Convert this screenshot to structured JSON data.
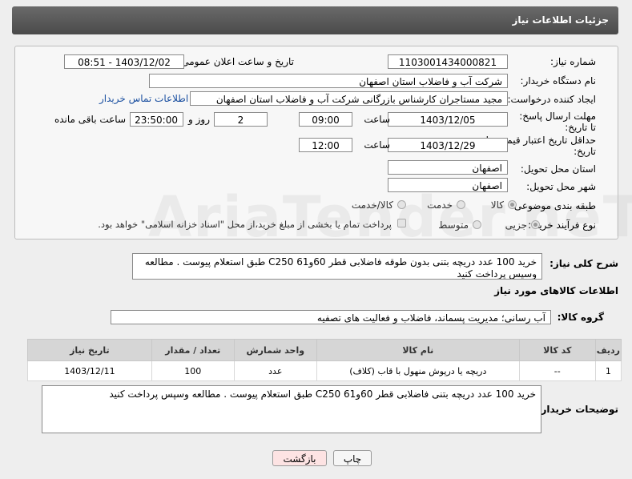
{
  "header": {
    "title": "جزئیات اطلاعات نیاز"
  },
  "fields": {
    "need_number_label": "شماره نیاز:",
    "need_number": "1103001434000821",
    "announce_label": "تاریخ و ساعت اعلان عمومی:",
    "announce_value": "1403/12/02 - 08:51",
    "buyer_org_label": "نام دستگاه خریدار:",
    "buyer_org": "شرکت آب و فاضلاب استان اصفهان",
    "creator_label": "ایجاد کننده درخواست:",
    "creator": "مجید مستاجران کارشناس بازرگانی شرکت آب و فاضلاب استان اصفهان",
    "contact_link": "اطلاعات تماس خریدار",
    "deadline_label": "مهلت ارسال پاسخ: تا تاریخ:",
    "deadline_date": "1403/12/05",
    "time_label": "ساعت",
    "deadline_time": "09:00",
    "days": "2",
    "days_label": "روز و",
    "remaining_time": "23:50:00",
    "remaining_label": "ساعت باقی مانده",
    "validity_label": "حداقل تاریخ اعتبار قیمت: تا تاریخ:",
    "validity_date": "1403/12/29",
    "validity_time": "12:00",
    "province_label": "استان محل تحویل:",
    "province": "اصفهان",
    "city_label": "شهر محل تحویل:",
    "city": "اصفهان",
    "category_label": "طبقه بندی موضوعی:",
    "category_options": [
      "کالا",
      "خدمت",
      "کالا/خدمت"
    ],
    "process_label": "نوع فرآیند خرید :",
    "process_options": [
      "جزیی",
      "متوسط"
    ],
    "payment_note": "پرداخت تمام یا بخشی از مبلغ خرید،از محل \"اسناد خزانه اسلامی\" خواهد بود."
  },
  "description": {
    "label": "شرح کلی نیاز:",
    "text": "خرید 100 عدد دریچه بتنی بدون طوقه  فاضلابی قطر 60و61 C250  طبق استعلام پیوست . مطالعه وسپس پرداخت کنید"
  },
  "goods": {
    "section_title": "اطلاعات کالاهای مورد نیاز",
    "group_label": "گروه کالا:",
    "group_value": "آب رسانی؛ مدیریت پسماند، فاضلاب و فعالیت های تصفیه",
    "columns": [
      "ردیف",
      "کد کالا",
      "نام کالا",
      "واحد شمارش",
      "تعداد / مقدار",
      "تاریخ نیاز"
    ],
    "rows": [
      {
        "row": "1",
        "code": "--",
        "name": "دریچه یا درپوش منهول با قاب (کلاف)",
        "unit": "عدد",
        "qty": "100",
        "date": "1403/12/11"
      }
    ]
  },
  "buyer_notes": {
    "label": "توضیحات خریدار:",
    "text": "خرید 100 عدد دریچه بتنی فاضلابی قطر 60و61 C250  طبق استعلام پیوست . مطالعه وسپس پرداخت کنید"
  },
  "buttons": {
    "print": "چاپ",
    "back": "بازگشت"
  },
  "watermark": "AriaTender.neT",
  "colors": {
    "header_bg": "#555555",
    "link": "#1a4fa0",
    "back_button_bg": "#fde3e3"
  }
}
